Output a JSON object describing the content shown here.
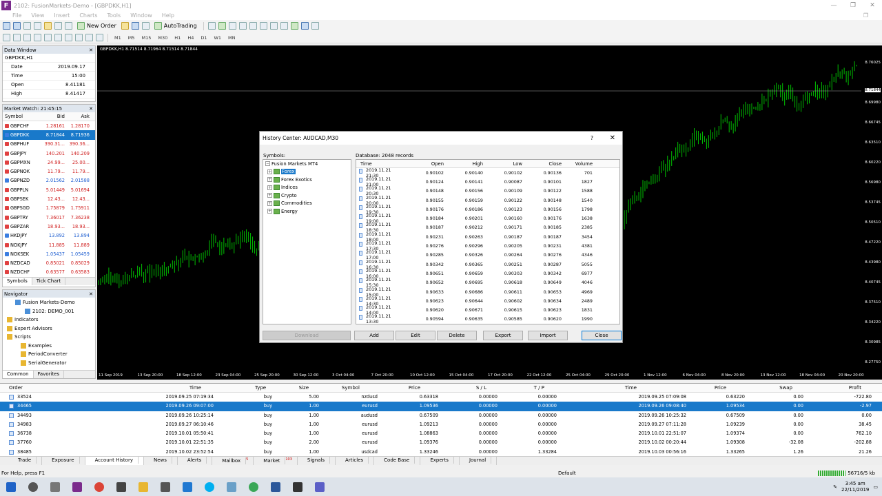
{
  "window": {
    "title": "2102: FusionMarkets-Demo - [GBPDKK,H1]",
    "menu": [
      "File",
      "View",
      "Insert",
      "Charts",
      "Tools",
      "Window",
      "Help"
    ]
  },
  "toolbar": {
    "new_order": "New Order",
    "auto_trading": "AutoTrading",
    "timeframes": [
      "M1",
      "M5",
      "M15",
      "M30",
      "H1",
      "H4",
      "D1",
      "W1",
      "MN"
    ]
  },
  "data_window": {
    "title": "Data Window",
    "symbol": "GBPDKK,H1",
    "rows": [
      {
        "k": "Date",
        "v": "2019.09.17"
      },
      {
        "k": "Time",
        "v": "15:00"
      },
      {
        "k": "Open",
        "v": "8.41181"
      },
      {
        "k": "High",
        "v": "8.41417"
      }
    ]
  },
  "market_watch": {
    "title": "Market Watch: 21:45:15",
    "headers": [
      "Symbol",
      "Bid",
      "Ask"
    ],
    "rows": [
      {
        "s": "GBPCHF",
        "bid": "1.28161",
        "ask": "1.28170",
        "dir": "dn"
      },
      {
        "s": "GBPDKK",
        "bid": "8.71844",
        "ask": "8.71936",
        "dir": "up",
        "sel": true
      },
      {
        "s": "GBPHUF",
        "bid": "390.31...",
        "ask": "390.36...",
        "dir": "dn"
      },
      {
        "s": "GBPJPY",
        "bid": "140.201",
        "ask": "140.209",
        "dir": "dn"
      },
      {
        "s": "GBPMXN",
        "bid": "24.99...",
        "ask": "25.00...",
        "dir": "dn"
      },
      {
        "s": "GBPNOK",
        "bid": "11.79...",
        "ask": "11.79...",
        "dir": "dn"
      },
      {
        "s": "GBPNZD",
        "bid": "2.01562",
        "ask": "2.01588",
        "dir": "up"
      },
      {
        "s": "GBPPLN",
        "bid": "5.01449",
        "ask": "5.01694",
        "dir": "dn"
      },
      {
        "s": "GBPSEK",
        "bid": "12.43...",
        "ask": "12.43...",
        "dir": "dn"
      },
      {
        "s": "GBPSGD",
        "bid": "1.75879",
        "ask": "1.75911",
        "dir": "dn"
      },
      {
        "s": "GBPTRY",
        "bid": "7.36017",
        "ask": "7.36238",
        "dir": "dn"
      },
      {
        "s": "GBPZAR",
        "bid": "18.93...",
        "ask": "18.93...",
        "dir": "dn"
      },
      {
        "s": "HKDJPY",
        "bid": "13.892",
        "ask": "13.894",
        "dir": "up"
      },
      {
        "s": "NOKJPY",
        "bid": "11.885",
        "ask": "11.889",
        "dir": "dn"
      },
      {
        "s": "NOKSEK",
        "bid": "1.05437",
        "ask": "1.05459",
        "dir": "up"
      },
      {
        "s": "NZDCAD",
        "bid": "0.85021",
        "ask": "0.85029",
        "dir": "dn"
      },
      {
        "s": "NZDCHF",
        "bid": "0.63577",
        "ask": "0.63583",
        "dir": "dn"
      }
    ],
    "tabs": [
      "Symbols",
      "Tick Chart"
    ]
  },
  "navigator": {
    "title": "Navigator",
    "items": [
      {
        "label": "Fusion Markets-Demo",
        "indent": 18
      },
      {
        "label": "2102: DEMO_001",
        "indent": 32
      },
      {
        "label": "Indicators",
        "indent": 6
      },
      {
        "label": "Expert Advisors",
        "indent": 6
      },
      {
        "label": "Scripts",
        "indent": 6
      },
      {
        "label": "Examples",
        "indent": 26
      },
      {
        "label": "PeriodConverter",
        "indent": 26
      },
      {
        "label": "SerialGenerator",
        "indent": 26
      }
    ],
    "tabs": [
      "Common",
      "Favorites"
    ]
  },
  "chart": {
    "label": "GBPDKK,H1 8.71514 8.71964 8.71514 8.71844",
    "price_ticks": [
      "8.76025",
      "8.71844",
      "8.69980",
      "8.66745",
      "8.63510",
      "8.60220",
      "8.56980",
      "8.53745",
      "8.50510",
      "8.47220",
      "8.43980",
      "8.40745",
      "8.37510",
      "8.34220",
      "8.30985",
      "8.27750"
    ],
    "time_ticks": [
      "11 Sep 2019",
      "13 Sep 20:00",
      "18 Sep 12:00",
      "23 Sep 04:00",
      "25 Sep 20:00",
      "30 Sep 12:00",
      "3 Oct 04:00",
      "7 Oct 20:00",
      "10 Oct 12:00",
      "15 Oct 04:00",
      "17 Oct 20:00",
      "22 Oct 12:00",
      "25 Oct 04:00",
      "29 Oct 20:00",
      "1 Nov 12:00",
      "6 Nov 04:00",
      "8 Nov 20:00",
      "13 Nov 12:00",
      "18 Nov 04:00",
      "20 Nov 20:00"
    ]
  },
  "history_center": {
    "title": "History Center: AUDCAD,M30",
    "help": "?",
    "symbols_label": "Symbols:",
    "database_label": "Database: 2048 records",
    "tree": [
      {
        "label": "Fusion Markets MT4",
        "level": 0
      },
      {
        "label": "Forex",
        "level": 1,
        "sel": true
      },
      {
        "label": "Forex Exotics",
        "level": 1
      },
      {
        "label": "Indices",
        "level": 1
      },
      {
        "label": "Crypto",
        "level": 1
      },
      {
        "label": "Commodities",
        "level": 1
      },
      {
        "label": "Energy",
        "level": 1
      }
    ],
    "headers": [
      "Time",
      "Open",
      "High",
      "Low",
      "Close",
      "Volume"
    ],
    "rows": [
      [
        "2019.11.21 21:30",
        "0.90102",
        "0.90140",
        "0.90102",
        "0.90136",
        "701"
      ],
      [
        "2019.11.21 21:00",
        "0.90124",
        "0.90141",
        "0.90087",
        "0.90101",
        "1827"
      ],
      [
        "2019.11.21 20:30",
        "0.90148",
        "0.90156",
        "0.90109",
        "0.90122",
        "1588"
      ],
      [
        "2019.11.21 20:00",
        "0.90155",
        "0.90159",
        "0.90122",
        "0.90148",
        "1540"
      ],
      [
        "2019.11.21 19:30",
        "0.90176",
        "0.90186",
        "0.90123",
        "0.90156",
        "1798"
      ],
      [
        "2019.11.21 19:00",
        "0.90184",
        "0.90201",
        "0.90160",
        "0.90176",
        "1638"
      ],
      [
        "2019.11.21 18:30",
        "0.90187",
        "0.90212",
        "0.90171",
        "0.90185",
        "2385"
      ],
      [
        "2019.11.21 18:00",
        "0.90231",
        "0.90263",
        "0.90187",
        "0.90187",
        "3454"
      ],
      [
        "2019.11.21 17:30",
        "0.90276",
        "0.90296",
        "0.90205",
        "0.90231",
        "4381"
      ],
      [
        "2019.11.21 17:00",
        "0.90285",
        "0.90326",
        "0.90264",
        "0.90276",
        "4346"
      ],
      [
        "2019.11.21 16:30",
        "0.90342",
        "0.90365",
        "0.90251",
        "0.90287",
        "5055"
      ],
      [
        "2019.11.21 16:00",
        "0.90651",
        "0.90659",
        "0.90303",
        "0.90342",
        "6977"
      ],
      [
        "2019.11.21 15:30",
        "0.90652",
        "0.90695",
        "0.90618",
        "0.90649",
        "4046"
      ],
      [
        "2019.11.21 15:00",
        "0.90633",
        "0.90686",
        "0.90611",
        "0.90653",
        "4969"
      ],
      [
        "2019.11.21 14:30",
        "0.90623",
        "0.90644",
        "0.90602",
        "0.90634",
        "2489"
      ],
      [
        "2019.11.21 14:00",
        "0.90620",
        "0.90671",
        "0.90615",
        "0.90623",
        "1831"
      ],
      [
        "2019.11.21 13:30",
        "0.90594",
        "0.90635",
        "0.90585",
        "0.90620",
        "1990"
      ]
    ],
    "buttons": {
      "download": "Download",
      "add": "Add",
      "edit": "Edit",
      "delete": "Delete",
      "export": "Export",
      "import": "Import",
      "close": "Close"
    }
  },
  "terminal": {
    "headers": [
      "Order",
      "Time",
      "Type",
      "Size",
      "Symbol",
      "Price",
      "S / L",
      "T / P",
      "Time",
      "Price",
      "Swap",
      "Profit"
    ],
    "rows": [
      [
        "33524",
        "2019.09.25 07:19:34",
        "buy",
        "5.00",
        "nzdusd",
        "0.63318",
        "0.00000",
        "0.00000",
        "2019.09.25 07:09:08",
        "0.63220",
        "0.00",
        "-722.80"
      ],
      [
        "34465",
        "2019.09.26 09:07:00",
        "buy",
        "1.00",
        "eurusd",
        "1.09536",
        "0.00000",
        "0.00000",
        "2019.09.26 09:08:40",
        "1.09534",
        "0.00",
        "-2.97"
      ],
      [
        "34493",
        "2019.09.26 10:25:14",
        "buy",
        "1.00",
        "audusd",
        "0.67509",
        "0.00000",
        "0.00000",
        "2019.09.26 10:25:32",
        "0.67509",
        "0.00",
        "0.00"
      ],
      [
        "34983",
        "2019.09.27 06:10:46",
        "buy",
        "1.00",
        "eurusd",
        "1.09213",
        "0.00000",
        "0.00000",
        "2019.09.27 07:11:28",
        "1.09239",
        "0.00",
        "38.45"
      ],
      [
        "36738",
        "2019.10.01 05:50:41",
        "buy",
        "1.00",
        "eurusd",
        "1.08863",
        "0.00000",
        "0.00000",
        "2019.10.01 22:51:07",
        "1.09374",
        "0.00",
        "762.10"
      ],
      [
        "37760",
        "2019.10.01 22:51:35",
        "buy",
        "2.00",
        "eurusd",
        "1.09376",
        "0.00000",
        "0.00000",
        "2019.10.02 00:20:44",
        "1.09308",
        "-32.08",
        "-202.88"
      ],
      [
        "38485",
        "2019.10.02 23:52:54",
        "buy",
        "1.00",
        "usdcad",
        "1.33246",
        "0.00000",
        "1.33284",
        "2019.10.03 00:56:16",
        "1.33265",
        "1.26",
        "21.26"
      ]
    ],
    "tabs": [
      "Trade",
      "Exposure",
      "Account History",
      "News",
      "Alerts",
      "Mailbox",
      "Market",
      "Signals",
      "Articles",
      "Code Base",
      "Experts",
      "Journal"
    ],
    "mailbox_badge": "5",
    "market_badge": "103",
    "side_label": "Terminal"
  },
  "status": {
    "help": "For Help, press F1",
    "profile": "Default",
    "traffic": "56716/5 kb"
  },
  "taskbar": {
    "time": "3:45 am",
    "date": "22/11/2019"
  },
  "colors": {
    "chart_bg": "#000000",
    "candle": "#00c000",
    "selection": "#1979ca",
    "bid_up": "#1f5fd1",
    "bid_down": "#d02020"
  }
}
